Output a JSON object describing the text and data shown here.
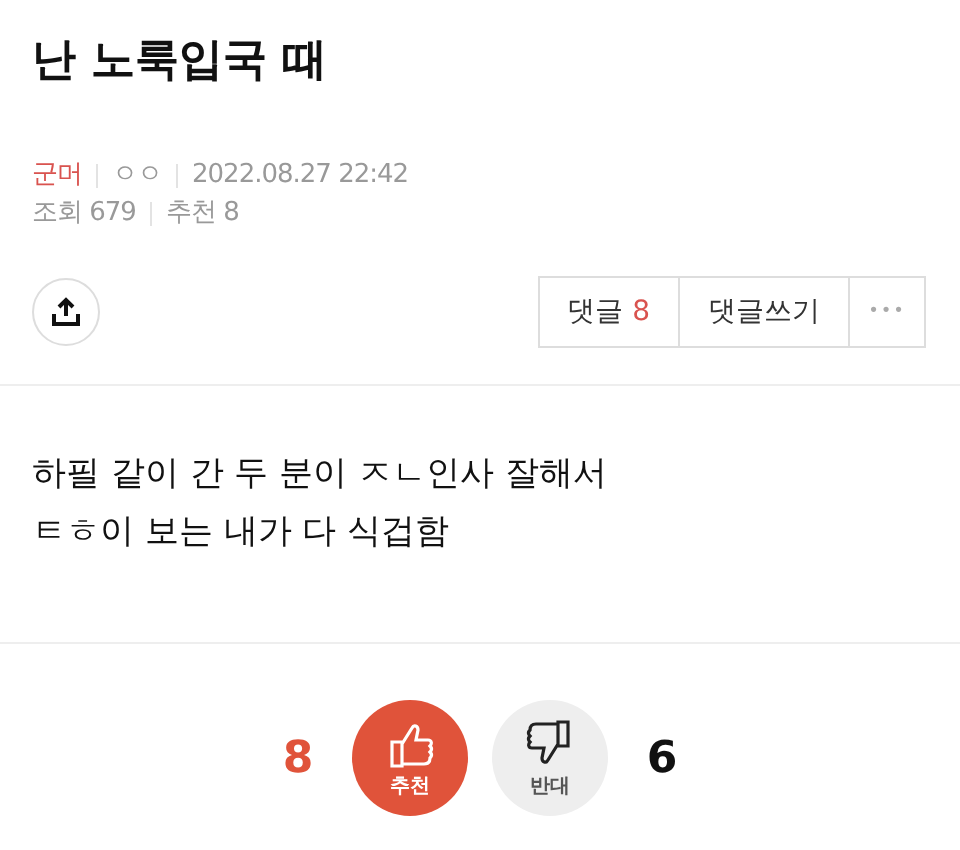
{
  "title": "난 노룩입국 때",
  "meta": {
    "category": "군머",
    "author": "ㅇㅇ",
    "date": "2022.08.27 22:42",
    "views_label": "조회",
    "views": "679",
    "recommend_label": "추천",
    "recommend": "8"
  },
  "actions": {
    "comments_label": "댓글",
    "comments_count": "8",
    "write_comment": "댓글쓰기",
    "more": "•••"
  },
  "body": [
    "하필 같이 간 두 분이 ㅈㄴ인사 잘해서",
    "ㅌㅎ이 보는 내가 다 식겁함"
  ],
  "votes": [
    {
      "kind": "up",
      "count": "8",
      "label": "추천"
    },
    {
      "kind": "down",
      "count": "6",
      "label": "반대"
    }
  ]
}
